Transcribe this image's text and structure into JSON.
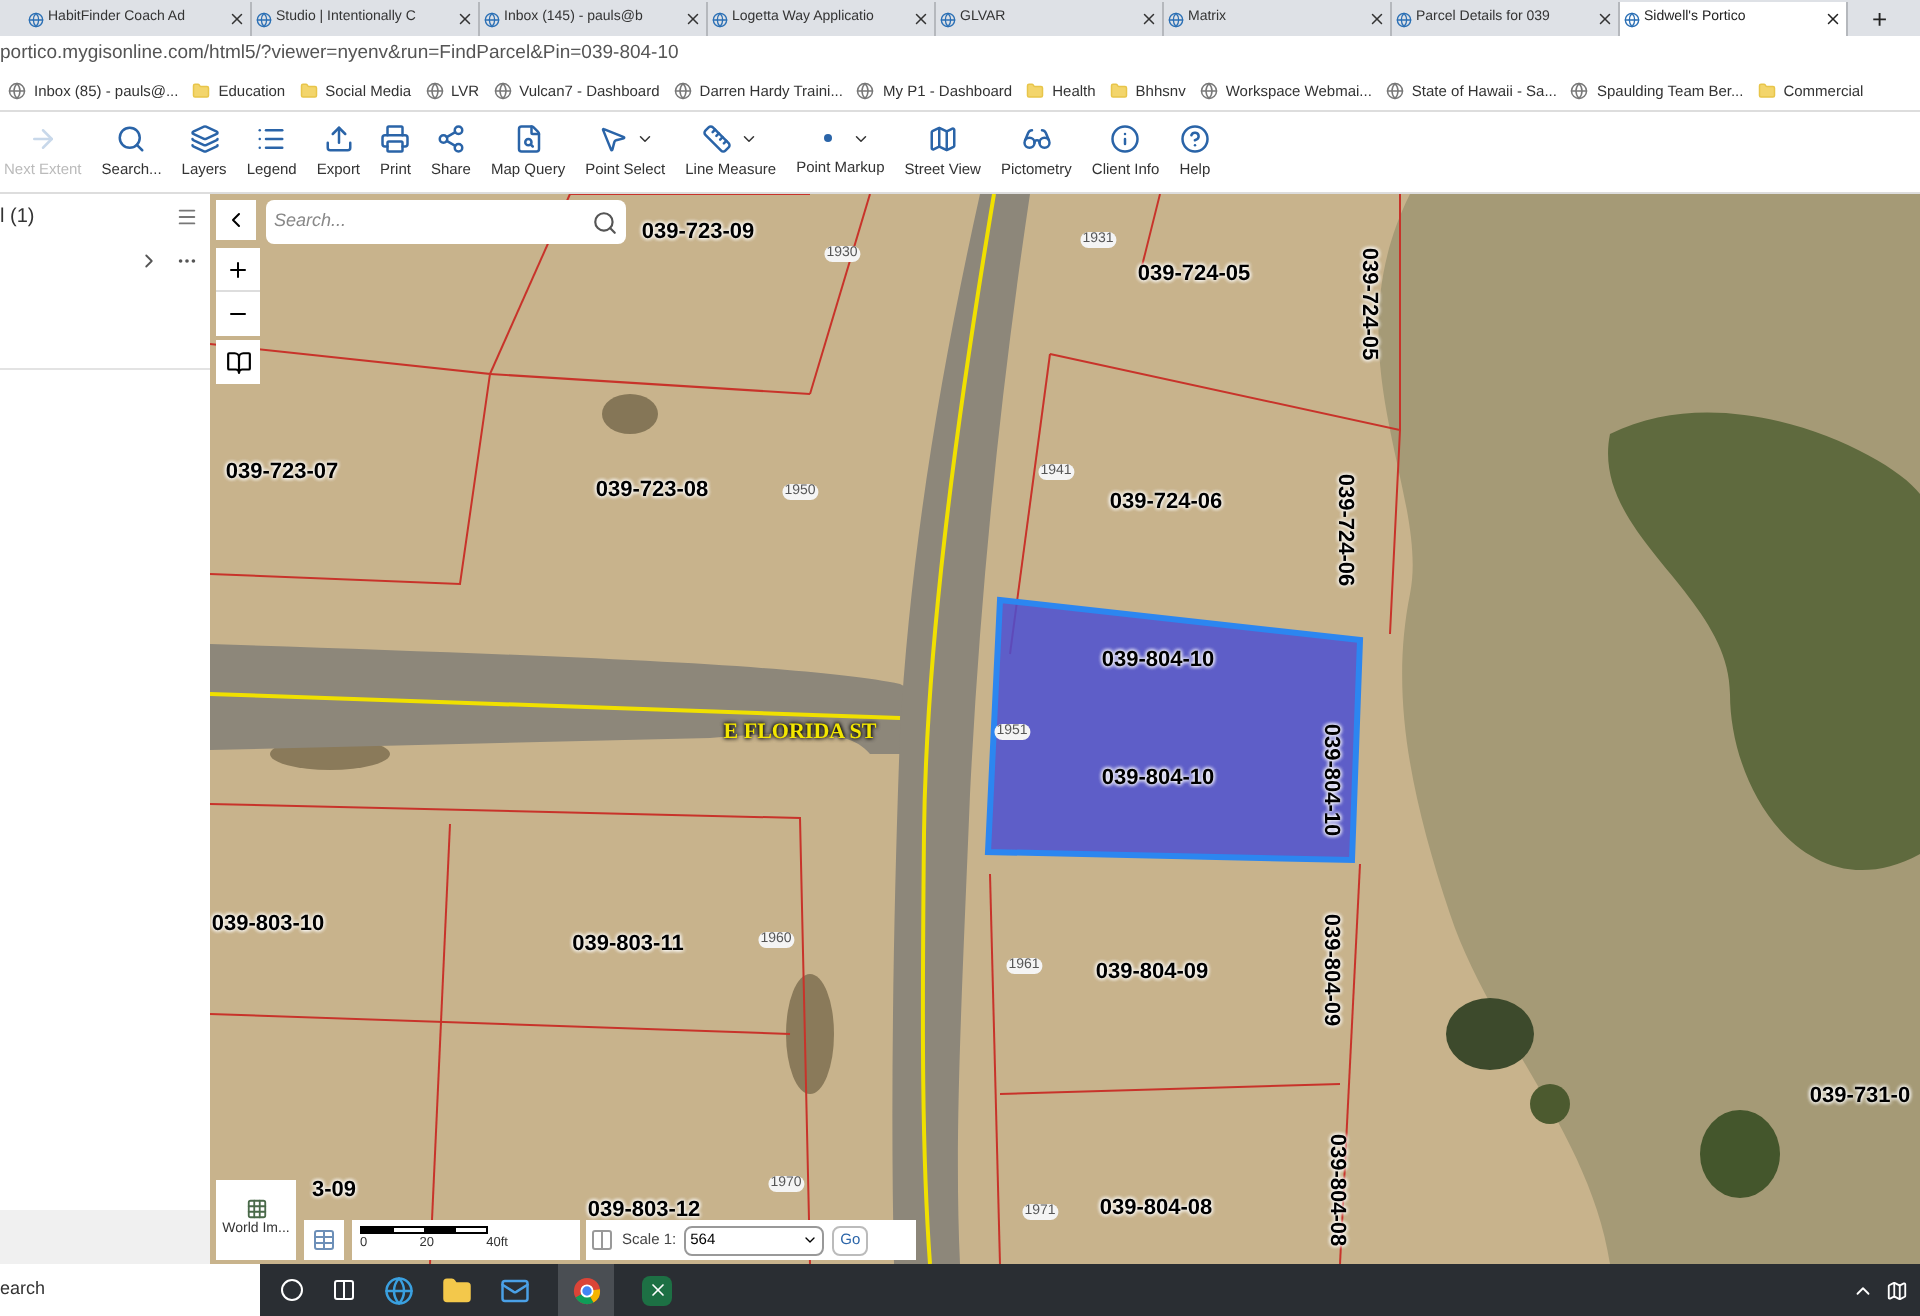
{
  "browser": {
    "tabs": [
      {
        "title": "HabitFinder Coach Ad",
        "selected": false
      },
      {
        "title": "Studio | Intentionally C",
        "selected": false
      },
      {
        "title": "Inbox (145) - pauls@b",
        "selected": false
      },
      {
        "title": "Logetta Way Applicatio",
        "selected": false
      },
      {
        "title": "GLVAR",
        "selected": false
      },
      {
        "title": "Matrix",
        "selected": false
      },
      {
        "title": "Parcel Details for 039",
        "selected": false
      },
      {
        "title": "Sidwell's Portico",
        "selected": true
      }
    ],
    "new_tab": "+",
    "address": "portico.mygisonline.com/html5/?viewer=nyenv&run=FindParcel&Pin=039-804-10",
    "bookmarks": [
      {
        "label": "Inbox (85) - pauls@...",
        "kind": "site"
      },
      {
        "label": "Education",
        "kind": "folder"
      },
      {
        "label": "Social Media",
        "kind": "folder"
      },
      {
        "label": "LVR",
        "kind": "site"
      },
      {
        "label": "Vulcan7 - Dashboard",
        "kind": "site"
      },
      {
        "label": "Darren Hardy Traini...",
        "kind": "site"
      },
      {
        "label": "My P1 - Dashboard",
        "kind": "site"
      },
      {
        "label": "Health",
        "kind": "folder"
      },
      {
        "label": "Bhhsnv",
        "kind": "folder"
      },
      {
        "label": "Workspace Webmai...",
        "kind": "site"
      },
      {
        "label": "State of Hawaii - Sa...",
        "kind": "site"
      },
      {
        "label": "Spaulding Team Ber...",
        "kind": "site"
      },
      {
        "label": "Commercial",
        "kind": "folder"
      }
    ]
  },
  "toolbar": [
    {
      "label": "Next Extent",
      "disabled": true,
      "dropdown": false
    },
    {
      "label": "Search...",
      "disabled": false,
      "dropdown": false
    },
    {
      "label": "Layers",
      "disabled": false,
      "dropdown": false
    },
    {
      "label": "Legend",
      "disabled": false,
      "dropdown": false
    },
    {
      "label": "Export",
      "disabled": false,
      "dropdown": false
    },
    {
      "label": "Print",
      "disabled": false,
      "dropdown": false
    },
    {
      "label": "Share",
      "disabled": false,
      "dropdown": false
    },
    {
      "label": "Map Query",
      "disabled": false,
      "dropdown": false
    },
    {
      "label": "Point Select",
      "disabled": false,
      "dropdown": true
    },
    {
      "label": "Line Measure",
      "disabled": false,
      "dropdown": true
    },
    {
      "label": "Point Markup",
      "disabled": false,
      "dropdown": true
    },
    {
      "label": "Street View",
      "disabled": false,
      "dropdown": false
    },
    {
      "label": "Pictometry",
      "disabled": false,
      "dropdown": false
    },
    {
      "label": "Client Info",
      "disabled": false,
      "dropdown": false
    },
    {
      "label": "Help",
      "disabled": false,
      "dropdown": false
    }
  ],
  "side_panel": {
    "title": "l (1)"
  },
  "map": {
    "search": {
      "placeholder": "Search..."
    },
    "labels": [
      {
        "text": "039-723-09",
        "kind": "parcel"
      },
      {
        "text": "1930",
        "kind": "house_number"
      },
      {
        "text": "1931",
        "kind": "house_number"
      },
      {
        "text": "039-724-05",
        "kind": "parcel"
      },
      {
        "text": "039-724-05",
        "kind": "parcel_vertical"
      },
      {
        "text": "039-723-07",
        "kind": "parcel"
      },
      {
        "text": "039-723-08",
        "kind": "parcel"
      },
      {
        "text": "1950",
        "kind": "house_number"
      },
      {
        "text": "1941",
        "kind": "house_number"
      },
      {
        "text": "039-724-06",
        "kind": "parcel"
      },
      {
        "text": "039-724-06",
        "kind": "parcel_vertical"
      },
      {
        "text": "039-804-10",
        "kind": "parcel"
      },
      {
        "text": "1951",
        "kind": "house_number"
      },
      {
        "text": "E FLORIDA ST",
        "kind": "street"
      },
      {
        "text": "039-804-10",
        "kind": "parcel"
      },
      {
        "text": "039-804-10",
        "kind": "parcel_vertical"
      },
      {
        "text": "039-803-10",
        "kind": "parcel"
      },
      {
        "text": "039-803-11",
        "kind": "parcel"
      },
      {
        "text": "1960",
        "kind": "house_number"
      },
      {
        "text": "1961",
        "kind": "house_number"
      },
      {
        "text": "039-804-09",
        "kind": "parcel"
      },
      {
        "text": "039-804-09",
        "kind": "parcel_vertical"
      },
      {
        "text": "039-731-0",
        "kind": "parcel"
      },
      {
        "text": "039-804-08",
        "kind": "parcel_vertical"
      },
      {
        "text": "1970",
        "kind": "house_number"
      },
      {
        "text": "3-09",
        "kind": "parcel"
      },
      {
        "text": "039-803-12",
        "kind": "parcel"
      },
      {
        "text": "1971",
        "kind": "house_number"
      },
      {
        "text": "039-804-08",
        "kind": "parcel"
      }
    ],
    "basemap": {
      "label": "World Im..."
    },
    "scale_bar": [
      "0",
      "20",
      "40ft"
    ],
    "scale": {
      "label": "Scale 1:",
      "value": "564",
      "go": "Go"
    }
  },
  "taskbar": {
    "search": "earch"
  }
}
